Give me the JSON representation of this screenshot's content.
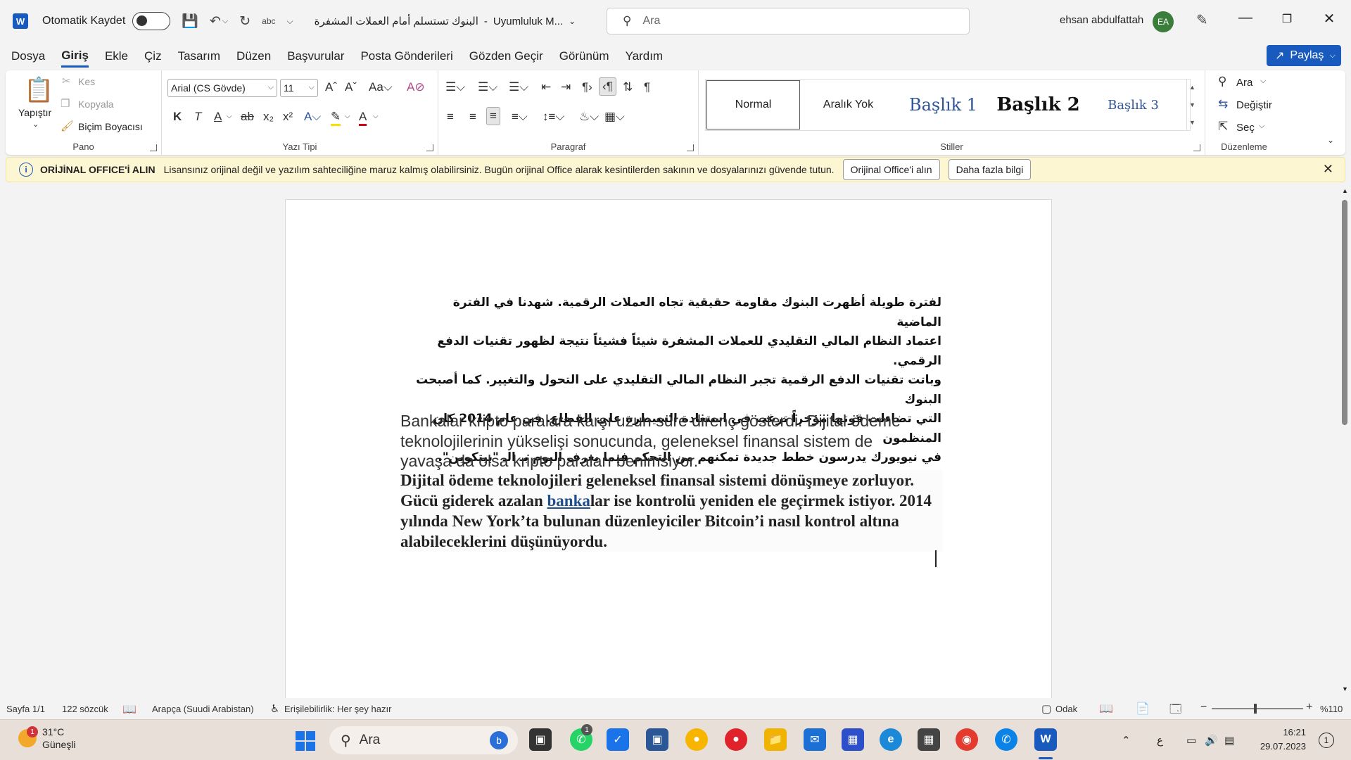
{
  "titlebar": {
    "app_logo": "W",
    "autosave_label": "Otomatik Kaydet",
    "doc_title": "البنوك تستسلم أمام العملات المشفرة",
    "doc_status": "Uyumluluk M...",
    "search_placeholder": "Ara",
    "user_name": "ehsan abdulfattah",
    "user_initials": "EA"
  },
  "menu": {
    "tabs": [
      "Dosya",
      "Giriş",
      "Ekle",
      "Çiz",
      "Tasarım",
      "Düzen",
      "Başvurular",
      "Posta Gönderileri",
      "Gözden Geçir",
      "Görünüm",
      "Yardım"
    ],
    "active_tab": "Giriş",
    "share_label": "Paylaş"
  },
  "ribbon": {
    "clipboard": {
      "paste_label": "Yapıştır",
      "cut_label": "Kes",
      "copy_label": "Kopyala",
      "format_painter_label": "Biçim Boyacısı",
      "group_label": "Pano"
    },
    "font": {
      "font_name": "Arial (CS Gövde)",
      "font_size": "11",
      "bold_label": "K",
      "italic_label": "T",
      "underline_label": "A",
      "group_label": "Yazı Tipi"
    },
    "paragraph": {
      "group_label": "Paragraf"
    },
    "styles": {
      "items": [
        "Normal",
        "Aralık Yok",
        "Başlık 1",
        "Başlık 2",
        "Başlık 3"
      ],
      "selected": "Normal",
      "group_label": "Stiller"
    },
    "editing": {
      "find_label": "Ara",
      "replace_label": "Değiştir",
      "select_label": "Seç",
      "group_label": "Düzenleme"
    }
  },
  "notification": {
    "title": "ORİJİNAL OFFICE'İ ALIN",
    "message": "Lisansınız orijinal değil ve yazılım sahteciliğine maruz kalmış olabilirsiniz. Bugün orijinal Office alarak kesintilerden sakının ve dosyalarınızı güvende tutun.",
    "button_primary": "Orijinal Office'i alın",
    "button_secondary": "Daha fazla bilgi"
  },
  "document": {
    "arabic_paragraph_lines": [
      "لفترة طويلة أظهرت البنوك مقاومة حقيقية تجاه العملات الرقمية. شهدنا في الفترة الماضية",
      "اعتماد النظام المالي التقليدي للعملات المشفرة شيئاً فشيئاً نتيجة لظهور تقنيات الدفع الرقمي.",
      "وباتت تقنيات الدفع الرقمية تجبر النظام المالي التقليدي على التحول والتغيير. كما أصبحت البنوك",
      "التي تضاءلت قوتها مؤخراً ترغب في استعادة السيطرة على القطاع. في عام 2014 كان المنظمون",
      "في نيويورك يدرسون خطط جديدة تمكنهم من التحكم فيما يعرف اليوم بـ الـ \"بيتكوين\"."
    ],
    "turkish_paragraph": "Bankalar kripto paralara karşı uzun süre direnç gösterdi. Dijital ödeme teknolojilerinin yükselişi sonucunda, geleneksel finansal sistem de yavaşa da olsa kripto paraları benimsiyor.",
    "turkish_bold_before": "Dijital ödeme teknolojileri geleneksel finansal sistemi dönüşmeye zorluyor. Gücü giderek azalan ",
    "turkish_bold_link": "banka",
    "turkish_bold_after": "lar ise kontrolü yeniden ele geçirmek istiyor. 2014 yılında New York’ta bulunan düzenleyiciler Bitcoin’i nasıl kontrol altına alabileceklerini düşünüyordu."
  },
  "statusbar": {
    "page": "Sayfa 1/1",
    "words": "122 sözcük",
    "language": "Arapça (Suudi Arabistan)",
    "accessibility": "Erişilebilirlik: Her şey hazır",
    "focus": "Odak",
    "zoom": "%110"
  },
  "taskbar": {
    "weather_temp": "31°C",
    "weather_desc": "Güneşli",
    "weather_badge": "1",
    "search_placeholder": "Ara",
    "whatsapp_badge": "1",
    "lang_indicator": "ع",
    "time": "16:21",
    "date": "29.07.2023",
    "notification_count": "1"
  }
}
